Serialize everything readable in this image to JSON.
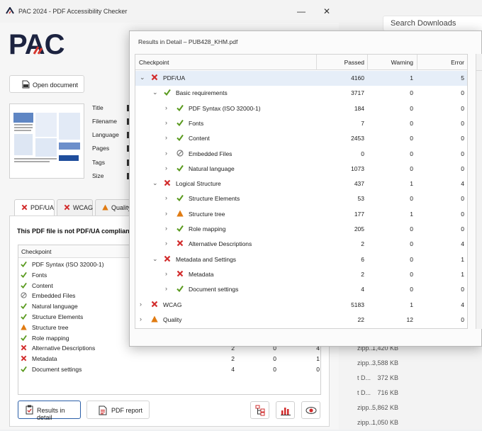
{
  "explorer": {
    "search_placeholder": "Search Downloads",
    "rows": [
      {
        "type": "zipp...",
        "size": "1,420 KB"
      },
      {
        "type": "zipp...",
        "size": "3,588 KB"
      },
      {
        "type": "t D...",
        "size": "372 KB"
      },
      {
        "type": "t D...",
        "size": "716 KB"
      },
      {
        "type": "zipp...",
        "size": "5,862 KB"
      },
      {
        "type": "zipp...",
        "size": "1,050 KB"
      }
    ]
  },
  "main_window": {
    "title": "PAC 2024 - PDF Accessibility Checker",
    "logo_text": "PAC",
    "open_document": "Open document",
    "meta_labels": [
      "Title",
      "Filename",
      "Language",
      "Pages",
      "Tags",
      "Size"
    ],
    "tabs": [
      {
        "label": "PDF/UA",
        "status": "error"
      },
      {
        "label": "WCAG",
        "status": "error"
      },
      {
        "label": "Quality",
        "status": "warning"
      }
    ],
    "compliance_message": "This PDF file is not PDF/UA compliant.",
    "checkpoint_header": "Checkpoint",
    "checkpoints": [
      {
        "name": "PDF Syntax (ISO 32000-1)",
        "status": "pass",
        "passed": "",
        "warning": "",
        "error": ""
      },
      {
        "name": "Fonts",
        "status": "pass",
        "passed": "",
        "warning": "",
        "error": ""
      },
      {
        "name": "Content",
        "status": "pass",
        "passed": "",
        "warning": "",
        "error": ""
      },
      {
        "name": "Embedded Files",
        "status": "na",
        "passed": "",
        "warning": "",
        "error": ""
      },
      {
        "name": "Natural language",
        "status": "pass",
        "passed": "",
        "warning": "",
        "error": ""
      },
      {
        "name": "Structure Elements",
        "status": "pass",
        "passed": "",
        "warning": "",
        "error": ""
      },
      {
        "name": "Structure tree",
        "status": "warning",
        "passed": "",
        "warning": "",
        "error": ""
      },
      {
        "name": "Role mapping",
        "status": "pass",
        "passed": "",
        "warning": "",
        "error": ""
      },
      {
        "name": "Alternative Descriptions",
        "status": "error",
        "passed": "2",
        "warning": "0",
        "error": "4"
      },
      {
        "name": "Metadata",
        "status": "error",
        "passed": "2",
        "warning": "0",
        "error": "1"
      },
      {
        "name": "Document settings",
        "status": "pass",
        "passed": "4",
        "warning": "0",
        "error": "0"
      }
    ],
    "results_in_detail": "Results in detail",
    "pdf_report": "PDF report"
  },
  "detail_window": {
    "title": "Results in Detail – PUB428_KHM.pdf",
    "columns": [
      "Checkpoint",
      "Passed",
      "Warning",
      "Error"
    ],
    "rows": [
      {
        "level": 0,
        "expander": "open",
        "status": "error",
        "label": "PDF/UA",
        "passed": "4160",
        "warning": "1",
        "error": "5",
        "selected": true
      },
      {
        "level": 1,
        "expander": "open",
        "status": "pass",
        "label": "Basic requirements",
        "passed": "3717",
        "warning": "0",
        "error": "0"
      },
      {
        "level": 2,
        "expander": "closed",
        "status": "pass",
        "label": "PDF Syntax (ISO 32000-1)",
        "passed": "184",
        "warning": "0",
        "error": "0"
      },
      {
        "level": 2,
        "expander": "closed",
        "status": "pass",
        "label": "Fonts",
        "passed": "7",
        "warning": "0",
        "error": "0"
      },
      {
        "level": 2,
        "expander": "closed",
        "status": "pass",
        "label": "Content",
        "passed": "2453",
        "warning": "0",
        "error": "0"
      },
      {
        "level": 2,
        "expander": "closed",
        "status": "na",
        "label": "Embedded Files",
        "passed": "0",
        "warning": "0",
        "error": "0"
      },
      {
        "level": 2,
        "expander": "closed",
        "status": "pass",
        "label": "Natural language",
        "passed": "1073",
        "warning": "0",
        "error": "0"
      },
      {
        "level": 1,
        "expander": "open",
        "status": "error",
        "label": "Logical Structure",
        "passed": "437",
        "warning": "1",
        "error": "4"
      },
      {
        "level": 2,
        "expander": "closed",
        "status": "pass",
        "label": "Structure Elements",
        "passed": "53",
        "warning": "0",
        "error": "0"
      },
      {
        "level": 2,
        "expander": "closed",
        "status": "warning",
        "label": "Structure tree",
        "passed": "177",
        "warning": "1",
        "error": "0"
      },
      {
        "level": 2,
        "expander": "closed",
        "status": "pass",
        "label": "Role mapping",
        "passed": "205",
        "warning": "0",
        "error": "0"
      },
      {
        "level": 2,
        "expander": "closed",
        "status": "error",
        "label": "Alternative Descriptions",
        "passed": "2",
        "warning": "0",
        "error": "4"
      },
      {
        "level": 1,
        "expander": "open",
        "status": "error",
        "label": "Metadata and Settings",
        "passed": "6",
        "warning": "0",
        "error": "1"
      },
      {
        "level": 2,
        "expander": "closed",
        "status": "error",
        "label": "Metadata",
        "passed": "2",
        "warning": "0",
        "error": "1"
      },
      {
        "level": 2,
        "expander": "closed",
        "status": "pass",
        "label": "Document settings",
        "passed": "4",
        "warning": "0",
        "error": "0"
      },
      {
        "level": 0,
        "expander": "closed",
        "status": "error",
        "label": "WCAG",
        "passed": "5183",
        "warning": "1",
        "error": "4"
      },
      {
        "level": 0,
        "expander": "closed",
        "status": "warning",
        "label": "Quality",
        "passed": "22",
        "warning": "12",
        "error": "0"
      }
    ]
  },
  "colors": {
    "pass": "#5a9a1f",
    "error": "#d22c2c",
    "warning": "#e07b12",
    "na": "#7a7a7a",
    "logo_dark": "#1c2340",
    "logo_accent": "#d7372f"
  }
}
